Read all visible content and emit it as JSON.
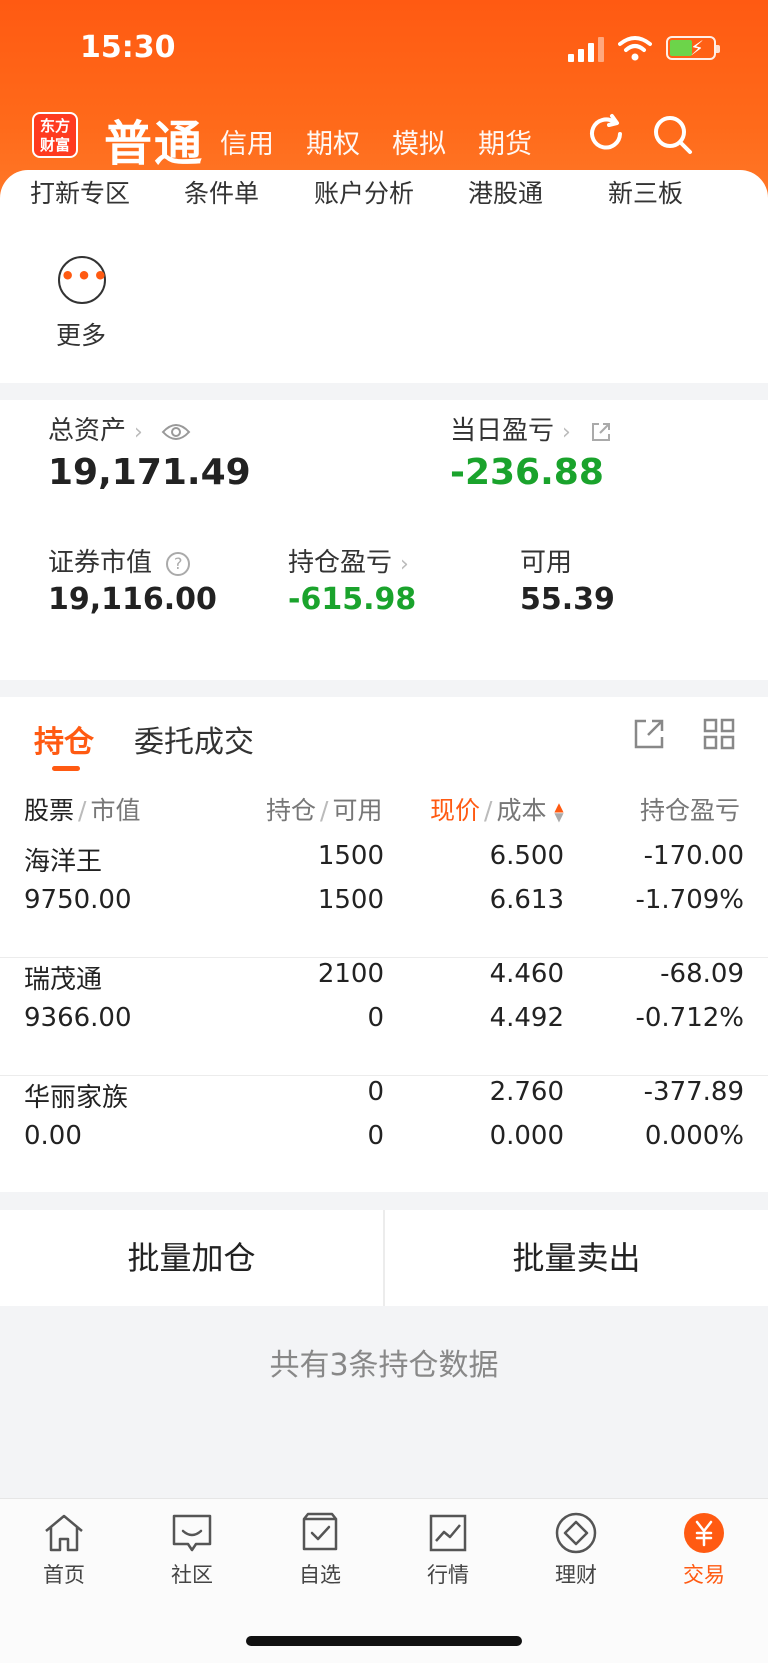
{
  "status": {
    "time": "15:30"
  },
  "header": {
    "logo": "东方\n财富",
    "account_type": "普通",
    "tabs": [
      "信用",
      "期权",
      "模拟",
      "期货"
    ]
  },
  "quick_actions": [
    "打新专区",
    "条件单",
    "账户分析",
    "港股通",
    "新三板"
  ],
  "more": {
    "label": "更多"
  },
  "assets": {
    "total_label": "总资产",
    "total_value": "19,171.49",
    "daily_label": "当日盈亏",
    "daily_value": "-236.88",
    "market_label": "证券市值",
    "market_value": "19,116.00",
    "holding_pl_label": "持仓盈亏",
    "holding_pl_value": "-615.98",
    "available_label": "可用",
    "available_value": "55.39"
  },
  "positions": {
    "tab_active": "持仓",
    "tab_other": "委托成交",
    "col1a": "股票",
    "col1b": "市值",
    "col2a": "持仓",
    "col2b": "可用",
    "col3a": "现价",
    "col3b": "成本",
    "col4": "持仓盈亏",
    "rows": [
      {
        "name": "海洋王",
        "value": "9750.00",
        "hold": "1500",
        "avail": "1500",
        "price": "6.500",
        "cost": "6.613",
        "pl": "-170.00",
        "pl_pct": "-1.709%"
      },
      {
        "name": "瑞茂通",
        "value": "9366.00",
        "hold": "2100",
        "avail": "0",
        "price": "4.460",
        "cost": "4.492",
        "pl": "-68.09",
        "pl_pct": "-0.712%"
      },
      {
        "name": "华丽家族",
        "value": "0.00",
        "hold": "0",
        "avail": "0",
        "price": "2.760",
        "cost": "0.000",
        "pl": "-377.89",
        "pl_pct": "0.000%"
      }
    ]
  },
  "actions": {
    "batch_add": "批量加仓",
    "batch_sell": "批量卖出"
  },
  "summary": "共有3条持仓数据",
  "tabbar": [
    "首页",
    "社区",
    "自选",
    "行情",
    "理财",
    "交易"
  ],
  "colors": {
    "brand": "#ff5a12",
    "loss": "#1aa32c"
  }
}
